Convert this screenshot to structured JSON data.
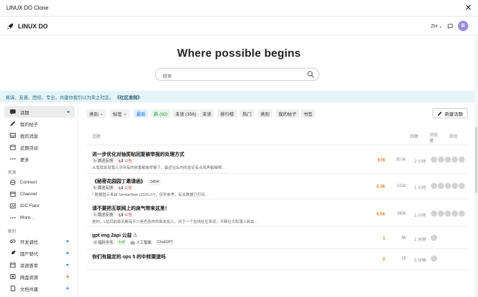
{
  "window": {
    "title": "LINUX DO Clone",
    "close_glyph": "✕"
  },
  "header": {
    "brand": "LINUX DO",
    "lang": "ZH",
    "avatar_letter": "B"
  },
  "hero": {
    "title": "Where possible begins",
    "search_placeholder": "搜索"
  },
  "banner": {
    "text": "真诚、友善、团结、专业，共建你我引以为荣之社区。",
    "link": "《社区准则》"
  },
  "sidebar": {
    "items": [
      {
        "label": "话题",
        "icon": "topics-icon",
        "active": true,
        "dot": true
      },
      {
        "label": "我的帖子",
        "icon": "pencil-icon"
      },
      {
        "label": "我的消息",
        "icon": "inbox-icon"
      },
      {
        "label": "近期活动",
        "icon": "calendar-icon"
      },
      {
        "label": "更多",
        "icon": "more-icon"
      }
    ],
    "resources_heading": "资源",
    "resources": [
      {
        "label": "Connect",
        "icon": "connect-icon"
      },
      {
        "label": "Channel",
        "icon": "channel-icon"
      },
      {
        "label": "IDC Flare",
        "icon": "flare-icon"
      },
      {
        "label": "More...",
        "icon": "ellipsis-icon"
      }
    ],
    "categories_heading": "类别",
    "categories": [
      {
        "label": "开发调优",
        "icon": "code-icon",
        "dot_color": "#3b82f6"
      },
      {
        "label": "国产替代",
        "icon": "rocket-icon",
        "dot_color": "#3b82f6"
      },
      {
        "label": "资源荟萃",
        "icon": "box-icon",
        "dot_color": "#3b82f6"
      },
      {
        "label": "网盘资源",
        "icon": "disk-icon",
        "dot_color": "#f97316"
      },
      {
        "label": "文档共建",
        "icon": "doc-icon",
        "dot_color": "#3b82f6"
      }
    ]
  },
  "nav": {
    "category": "类别",
    "tags": "标签",
    "latest": "最新",
    "new": "新 (92)",
    "unread": "未读 (356)",
    "unseen": "未读",
    "top": "排行榜",
    "hot": "热门",
    "categories": "类别",
    "my_posts": "我的帖子",
    "bookmarks": "书签",
    "new_topic": "新建话题"
  },
  "table": {
    "col_topic": "话题",
    "col_replies": "回复",
    "col_views": "浏览量",
    "col_activity": "活动",
    "rows": [
      {
        "title": "进一步优化对抽奖帖回复被举报的处理方式",
        "badge": "",
        "tags": [
          {
            "text": "↻ 跟进反馈",
            "kind": "plain"
          },
          {
            "text": "📢 公告",
            "kind": "red"
          }
        ],
        "excerpt": "从我我发现我几乎所有的放置都被举报了，最近论坛内的冒论有点风声鹤唳啊…",
        "replies": "678",
        "views": "30.0k",
        "activity": "2 小时"
      },
      {
        "title": "《秘密花园园丁邀请函》",
        "badge": "3454",
        "tags": [
          {
            "text": "↻ 跟进反馈",
            "kind": "plain"
          },
          {
            "text": "📢 公告",
            "kind": "red"
          }
        ],
        "excerpt": "* 数据图示来自 SimilarWeb (2025.07)，仅供参考。有关数据已打码…",
        "replies": "3.3k",
        "views": "232k",
        "activity": "1 小时"
      },
      {
        "title": "请不要把互联网上的戾气带来这里！",
        "badge": "",
        "tags": [
          {
            "text": "↻ 跟进反馈",
            "kind": "plain"
          },
          {
            "text": "📢 公告",
            "kind": "red"
          }
        ],
        "excerpt": "是的，L站目前每天都有不少各色各样的新友加入。对于一个在线社区来说，不断壮大和涌入新血…",
        "replies": "5.5k",
        "views": "380k",
        "activity": "1 小时"
      },
      {
        "title": "gpt img 2api 公益 ⚠",
        "badge": "",
        "tags": [
          {
            "text": "⑤ 福利羊毛",
            "kind": "plain"
          },
          {
            "text": "Lv2",
            "kind": "green"
          },
          {
            "text": "🤖 人工智能",
            "kind": "dark"
          },
          {
            "text": "ChatGPT",
            "kind": "plain"
          }
        ],
        "excerpt": "",
        "replies": "1",
        "views": "46",
        "activity": "1 分钟"
      },
      {
        "title": "你们有稳定的 ops 5 的中转渠道吗",
        "badge": "",
        "tags": [],
        "excerpt": "…",
        "replies": "2",
        "views": "19",
        "activity": "5 分钟"
      }
    ]
  },
  "colors": {
    "accent": "#1a73e8",
    "banner_bg": "#e5f4f7",
    "reply_orange": "#e67e22",
    "avatar": "#9c8ed8"
  }
}
